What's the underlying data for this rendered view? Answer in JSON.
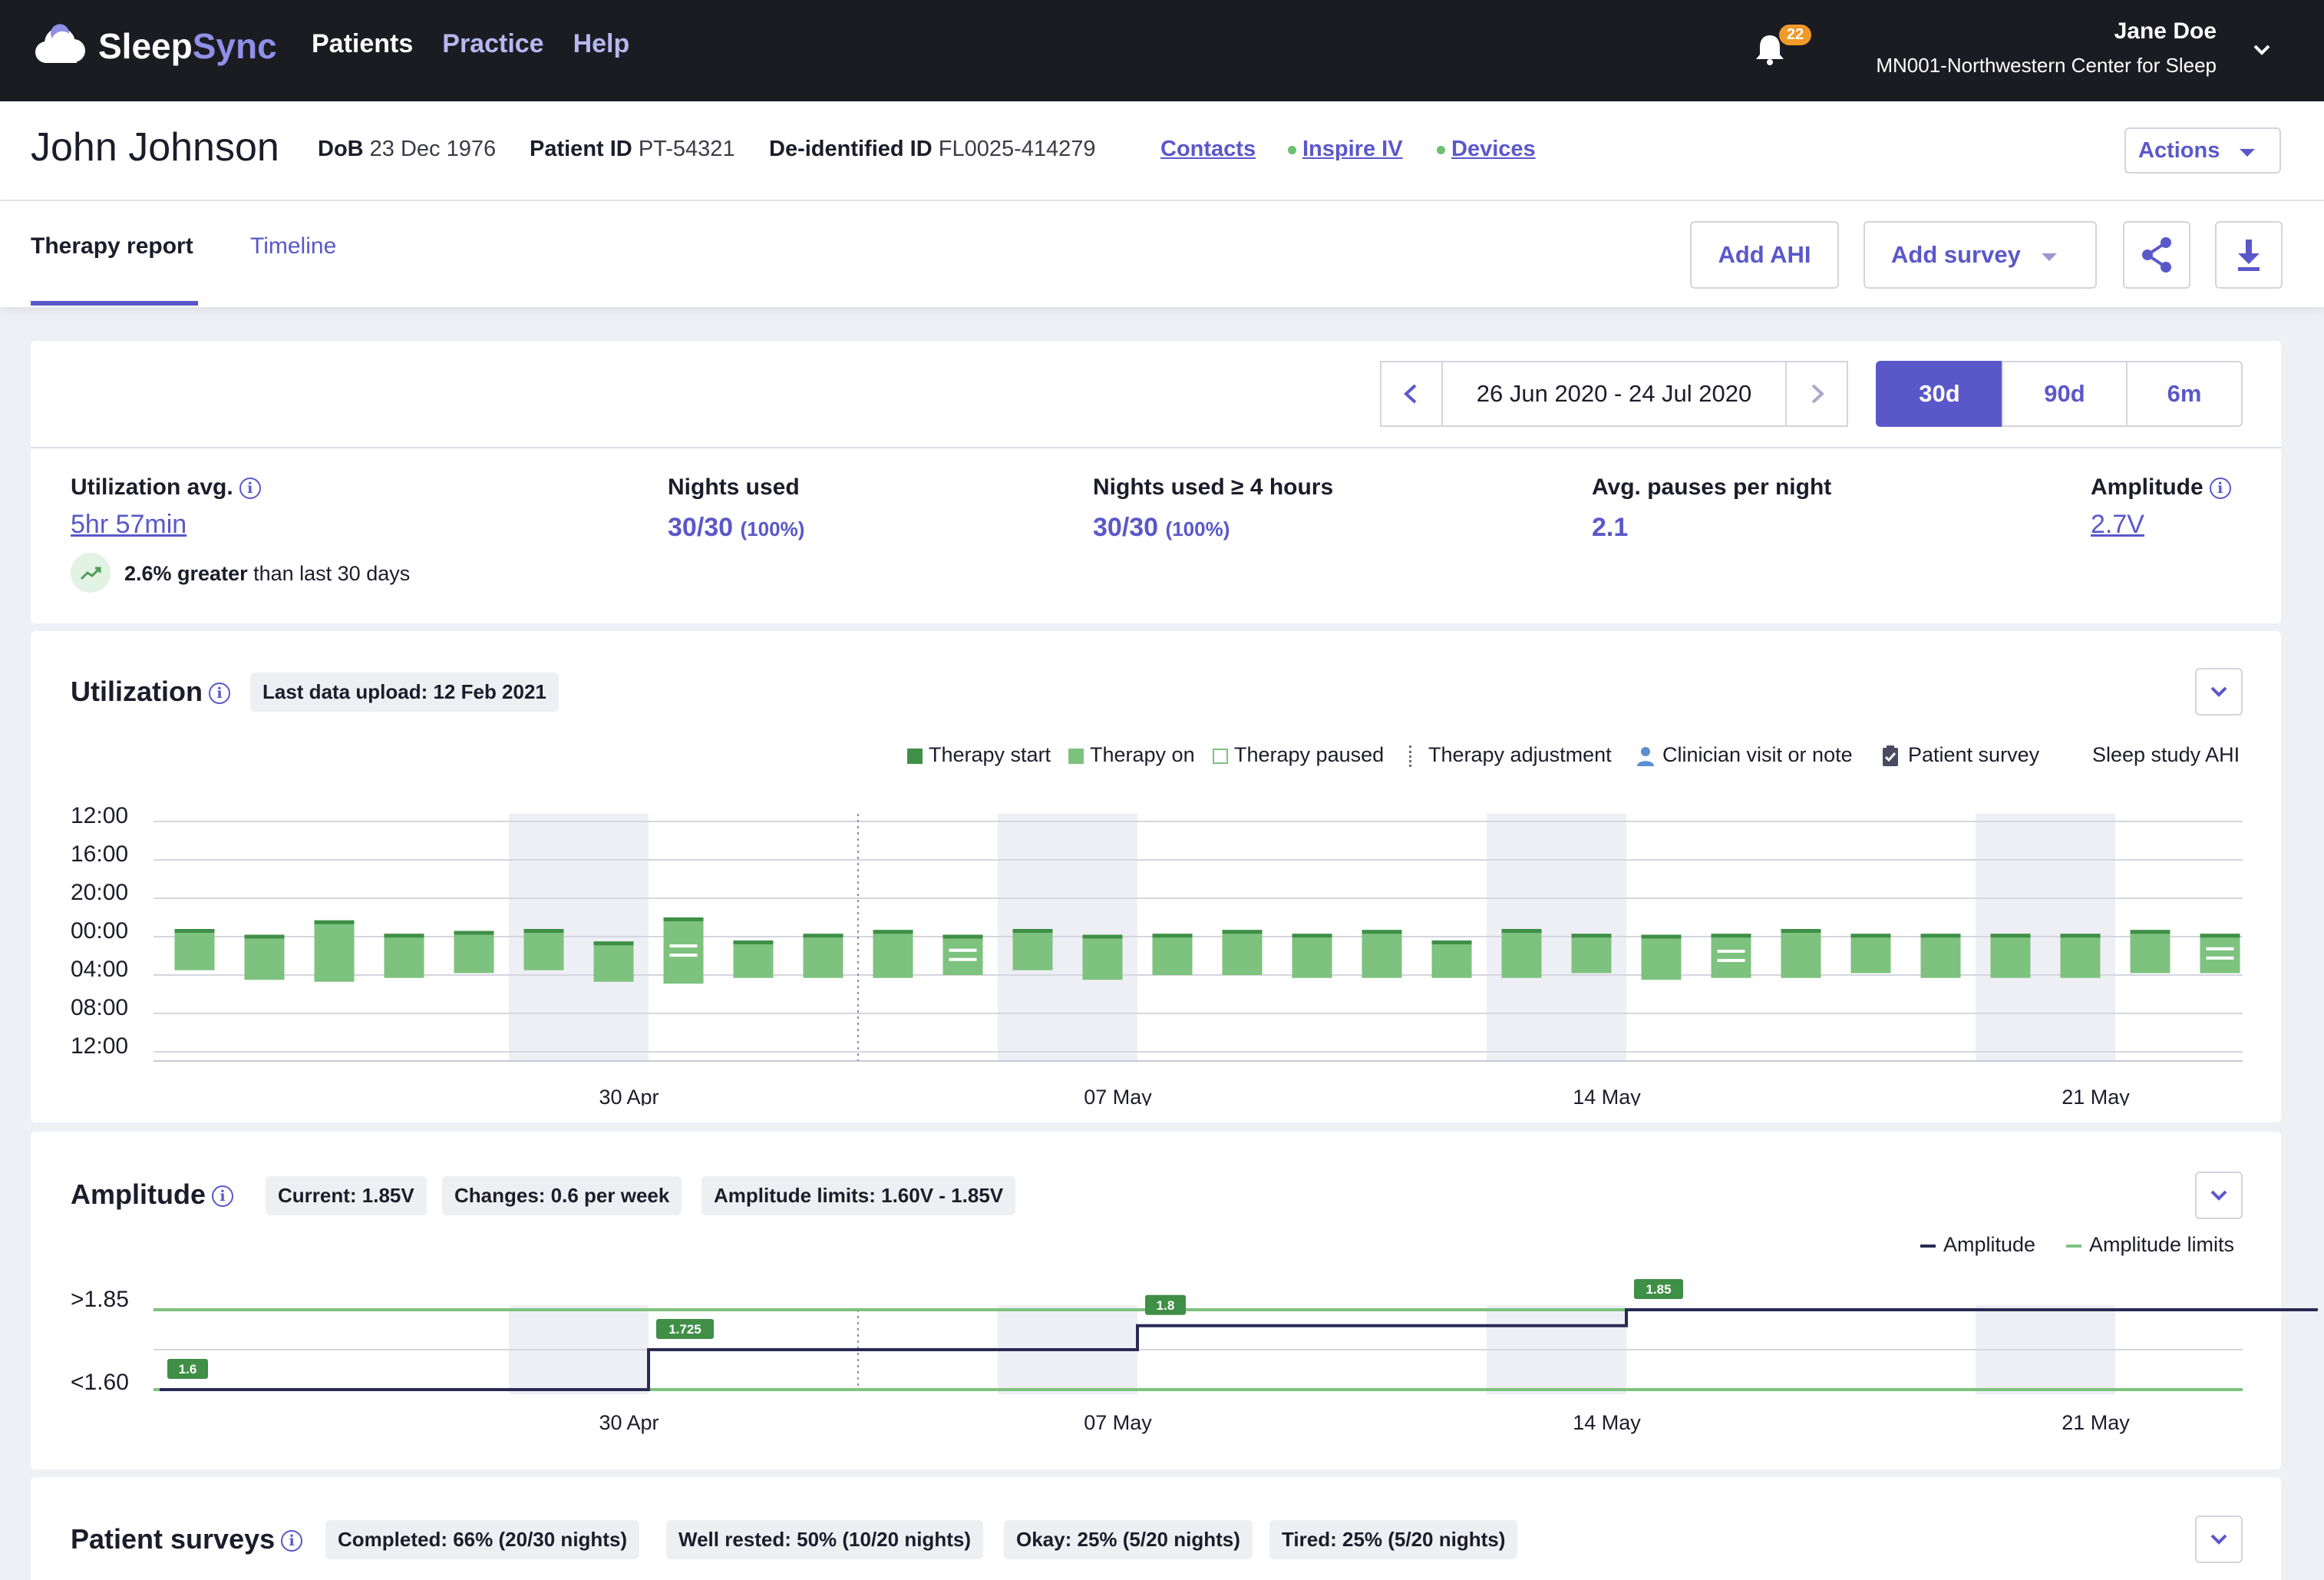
{
  "app": {
    "logo_sleep": "Sleep",
    "logo_sync": "Sync",
    "nav": [
      "Patients",
      "Practice",
      "Help"
    ],
    "notifications": "22"
  },
  "user": {
    "name": "Jane Doe",
    "org": "MN001-Northwestern Center for Sleep"
  },
  "patient": {
    "name": "John Johnson",
    "dob_label": "DoB",
    "dob": "23 Dec 1976",
    "id_label": "Patient ID",
    "id": "PT-54321",
    "deid_label": "De-identified ID",
    "deid": "FL0025-414279",
    "links": [
      "Contacts",
      "Inspire IV",
      "Devices"
    ],
    "actions": "Actions"
  },
  "tabs": [
    "Therapy report",
    "Timeline"
  ],
  "toolbar": {
    "add_ahi": "Add AHI",
    "add_survey": "Add survey"
  },
  "range": {
    "text": "26 Jun 2020 - 24 Jul 2020",
    "options": [
      "30d",
      "90d",
      "6m"
    ],
    "selected": "30d"
  },
  "stats": {
    "util_label": "Utilization avg.",
    "util_value": "5hr 57min",
    "trend_bold": "2.6% greater",
    "trend_rest": " than last 30 days",
    "nights_label": "Nights used",
    "nights_value": "30/30",
    "nights_pct": "(100%)",
    "nights4_label": "Nights used ≥ 4 hours",
    "nights4_value": "30/30",
    "nights4_pct": "(100%)",
    "pauses_label": "Avg. pauses per night",
    "pauses_value": "2.1",
    "amp_label": "Amplitude",
    "amp_value": "2.7V"
  },
  "utilization": {
    "title": "Utilization",
    "chip": "Last data upload: 12 Feb 2021",
    "legend": [
      "Therapy start",
      "Therapy on",
      "Therapy paused",
      "Therapy adjustment",
      "Clinician visit or note",
      "Patient survey",
      "Sleep study AHI"
    ]
  },
  "amplitude": {
    "title": "Amplitude",
    "chips": [
      "Current: 1.85V",
      "Changes: 0.6 per week",
      "Amplitude limits: 1.60V - 1.85V"
    ],
    "legend": [
      "Amplitude",
      "Amplitude limits"
    ]
  },
  "surveys": {
    "title": "Patient surveys",
    "chips": [
      "Completed: 66% (20/30 nights)",
      "Well rested: 50% (10/20 nights)",
      "Okay: 25% (5/20 nights)",
      "Tired: 25% (5/20 nights)"
    ]
  },
  "colors": {
    "accent": "#5a58c9",
    "therapy_on": "#7dc27e",
    "therapy_start": "#3f8f47",
    "amp_line": "#2a2a55",
    "limit_line": "#7dc27e"
  },
  "chart_data": [
    {
      "type": "bar",
      "title": "Utilization",
      "y_ticks": [
        "12:00",
        "16:00",
        "20:00",
        "00:00",
        "04:00",
        "08:00",
        "12:00"
      ],
      "x_ticks": [
        "30 Apr",
        "07 May",
        "14 May",
        "21 May"
      ],
      "x_tick_index": [
        6.5,
        13.5,
        20.5,
        27.5
      ],
      "weekend_bands": [
        [
          5,
          6
        ],
        [
          12,
          13
        ],
        [
          19,
          20
        ],
        [
          26,
          27
        ]
      ],
      "therapy_adjustment_index": 9.5,
      "nights": [
        {
          "start": 23.2,
          "end": 3.5
        },
        {
          "start": 23.8,
          "end": 4.5
        },
        {
          "start": 22.3,
          "end": 4.7
        },
        {
          "start": 23.7,
          "end": 4.3
        },
        {
          "start": 23.4,
          "end": 3.8
        },
        {
          "start": 23.2,
          "end": 3.5
        },
        {
          "start": 24.5,
          "end": 4.7,
          "pauses": 0
        },
        {
          "start": 22.0,
          "end": 4.9,
          "pauses": 2
        },
        {
          "start": 24.4,
          "end": 4.3
        },
        {
          "start": 23.7,
          "end": 4.3
        },
        {
          "start": 23.3,
          "end": 4.3
        },
        {
          "start": 23.8,
          "end": 4.0,
          "pauses": 2
        },
        {
          "start": 23.2,
          "end": 3.5
        },
        {
          "start": 23.8,
          "end": 4.5
        },
        {
          "start": 23.7,
          "end": 4.0
        },
        {
          "start": 23.3,
          "end": 4.0
        },
        {
          "start": 23.7,
          "end": 4.3
        },
        {
          "start": 23.3,
          "end": 4.3
        },
        {
          "start": 24.4,
          "end": 4.3
        },
        {
          "start": 23.2,
          "end": 4.3
        },
        {
          "start": 23.7,
          "end": 3.8
        },
        {
          "start": 23.8,
          "end": 4.5
        },
        {
          "start": 23.7,
          "end": 4.3,
          "pauses": 2
        },
        {
          "start": 23.2,
          "end": 4.3
        },
        {
          "start": 23.7,
          "end": 3.8
        },
        {
          "start": 23.7,
          "end": 4.3
        },
        {
          "start": 23.7,
          "end": 4.3
        },
        {
          "start": 23.7,
          "end": 4.3
        },
        {
          "start": 23.3,
          "end": 3.8
        },
        {
          "start": 23.7,
          "end": 3.8,
          "pauses": 2
        }
      ]
    },
    {
      "type": "line",
      "title": "Amplitude",
      "y_ticks": [
        ">1.85",
        "<1.60"
      ],
      "ylim": [
        1.6,
        1.85
      ],
      "x_ticks": [
        "30 Apr",
        "07 May",
        "14 May",
        "21 May"
      ],
      "x_tick_index": [
        6.5,
        13.5,
        20.5,
        27.5
      ],
      "limits": [
        1.6,
        1.85
      ],
      "steps": [
        {
          "x": 0,
          "value": 1.6,
          "label": "1.6"
        },
        {
          "x": 7,
          "value": 1.725,
          "label": "1.725"
        },
        {
          "x": 14,
          "value": 1.8,
          "label": "1.8"
        },
        {
          "x": 21,
          "value": 1.85,
          "label": "1.85"
        }
      ],
      "x_end": 30.9
    }
  ]
}
